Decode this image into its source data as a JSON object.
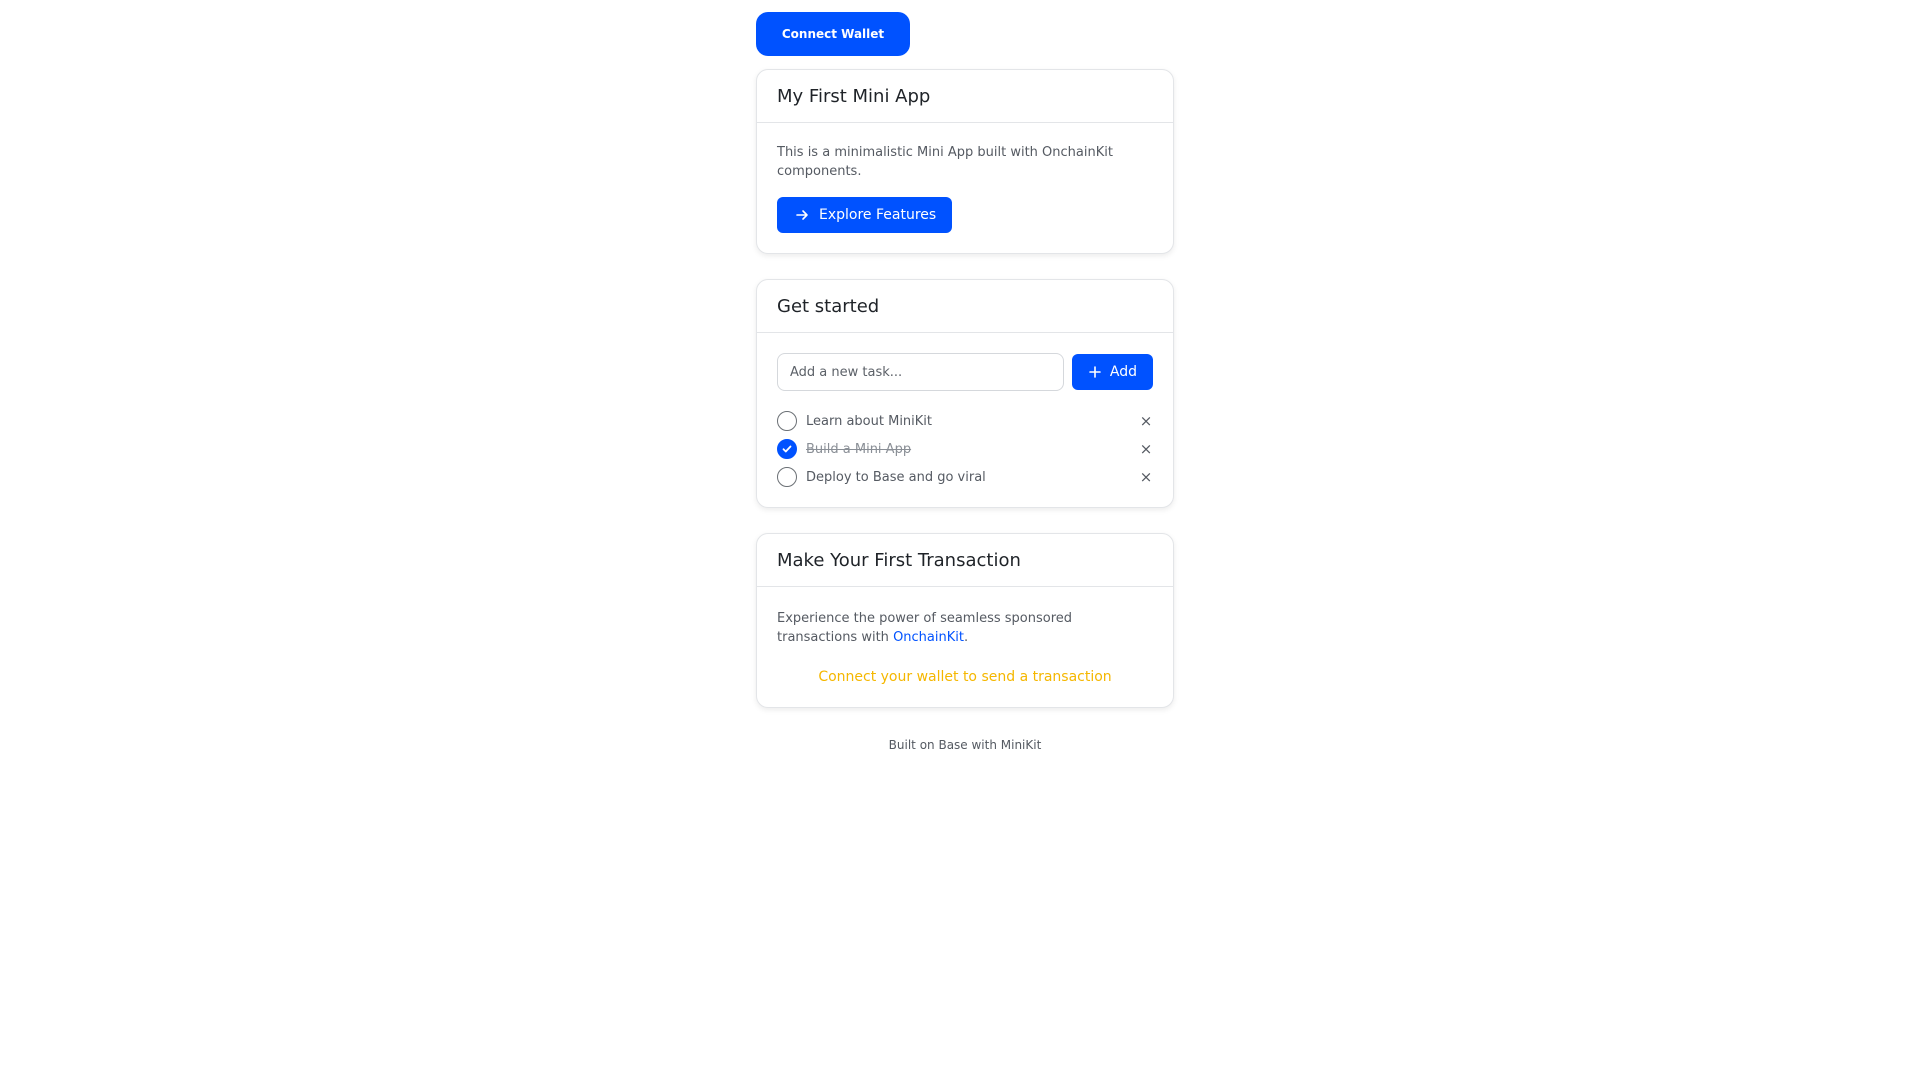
{
  "header": {
    "connect_label": "Connect Wallet"
  },
  "intro_card": {
    "title": "My First Mini App",
    "description": "This is a minimalistic Mini App built with OnchainKit components.",
    "button_label": "Explore Features",
    "button_icon": "arrow-right-icon"
  },
  "tasks_card": {
    "title": "Get started",
    "input_placeholder": "Add a new task...",
    "add_label": "Add",
    "add_icon": "plus-icon",
    "tasks": [
      {
        "label": "Learn about MiniKit",
        "completed": false
      },
      {
        "label": "Build a Mini App",
        "completed": true
      },
      {
        "label": "Deploy to Base and go viral",
        "completed": false
      }
    ],
    "remove_glyph": "×"
  },
  "transaction_card": {
    "title": "Make Your First Transaction",
    "description_prefix": "Experience the power of seamless sponsored transactions with ",
    "link_text": "OnchainKit",
    "description_suffix": ".",
    "status": "Connect your wallet to send a transaction"
  },
  "footer": {
    "text": "Built on Base with MiniKit"
  },
  "colors": {
    "accent": "#0052ff",
    "warning": "#f5b700",
    "text_muted": "#555a62"
  }
}
